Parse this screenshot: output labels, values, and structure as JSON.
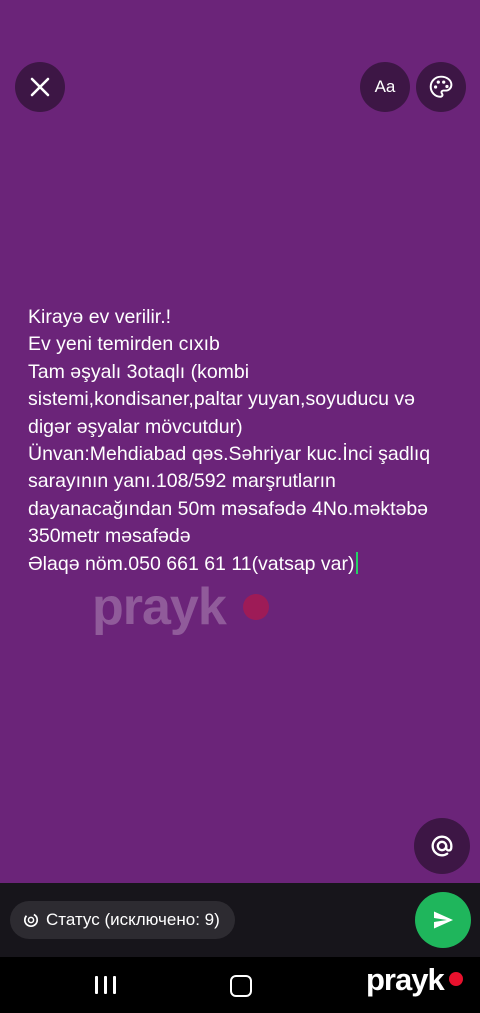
{
  "app": {
    "background_color": "#6b2479",
    "accent_color": "#1fb65c"
  },
  "toolbar": {
    "close_icon": "close-icon",
    "font_button_label": "Aa",
    "palette_icon": "palette-icon"
  },
  "status": {
    "lines": [
      "Kirayə ev verilir.!",
      "Ev yeni temirden cıxıb",
      "Tam əşyalı 3otaqlı (kombi",
      "sistemi,kondisaner,paltar yuyan,soyuducu və",
      "digər əşyalar mövcutdur)",
      "Ünvan:Mehdiabad qəs.Səhriyar kuc.İnci şadlıq",
      "sarayının yanı.108/592 marşrutların",
      "dayanacağından 50m məsafədə 4No.məktəbə",
      "350metr məsafədə",
      "Əlaqə nöm.050 661 61 11(vatsap var)"
    ]
  },
  "watermark": {
    "text": "prayk"
  },
  "footer": {
    "privacy_label": "Статус (исключено: 9)",
    "mention_icon": "at-icon",
    "send_icon": "send-icon"
  },
  "navbar": {
    "brand": "prayk"
  }
}
